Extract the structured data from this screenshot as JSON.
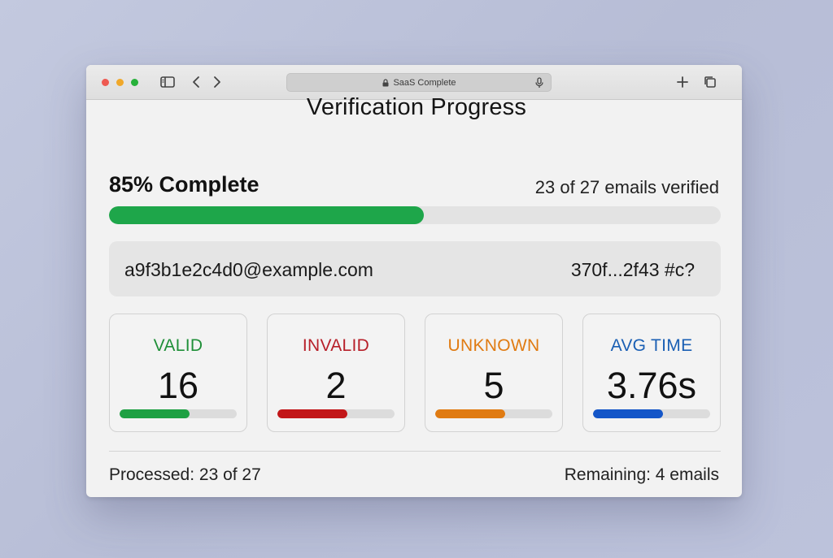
{
  "browser": {
    "address_text": "SaaS Complete"
  },
  "page": {
    "title": "Verification Progress",
    "progress_label": "85% Complete",
    "progress_fraction": 0.515,
    "verified_text": "23 of 27 emails verified",
    "current_email": "a9f3b1e2c4d0@example.com",
    "current_hash": "370f...2f43 #c?"
  },
  "stats": [
    {
      "label": "VALID",
      "value": "16",
      "color": "#1f8f38",
      "fill_color": "#1ea043",
      "fill_fraction": 0.6
    },
    {
      "label": "INVALID",
      "value": "2",
      "color": "#b7202a",
      "fill_color": "#c21618",
      "fill_fraction": 0.6
    },
    {
      "label": "UNKNOWN",
      "value": "5",
      "color": "#e07b12",
      "fill_color": "#e07b12",
      "fill_fraction": 0.6
    },
    {
      "label": "AVG TIME",
      "value": "3.76s",
      "color": "#1a5fb4",
      "fill_color": "#1456c8",
      "fill_fraction": 0.6
    }
  ],
  "footer": {
    "processed": "Processed: 23 of 27",
    "remaining": "Remaining: 4 emails"
  },
  "icons": {
    "titlebar": [
      "sidebar-icon",
      "chevron-left-icon",
      "chevron-right-icon",
      "plus-icon",
      "tabs-icon"
    ],
    "address": [
      "lock-icon",
      "microphone-icon"
    ]
  }
}
